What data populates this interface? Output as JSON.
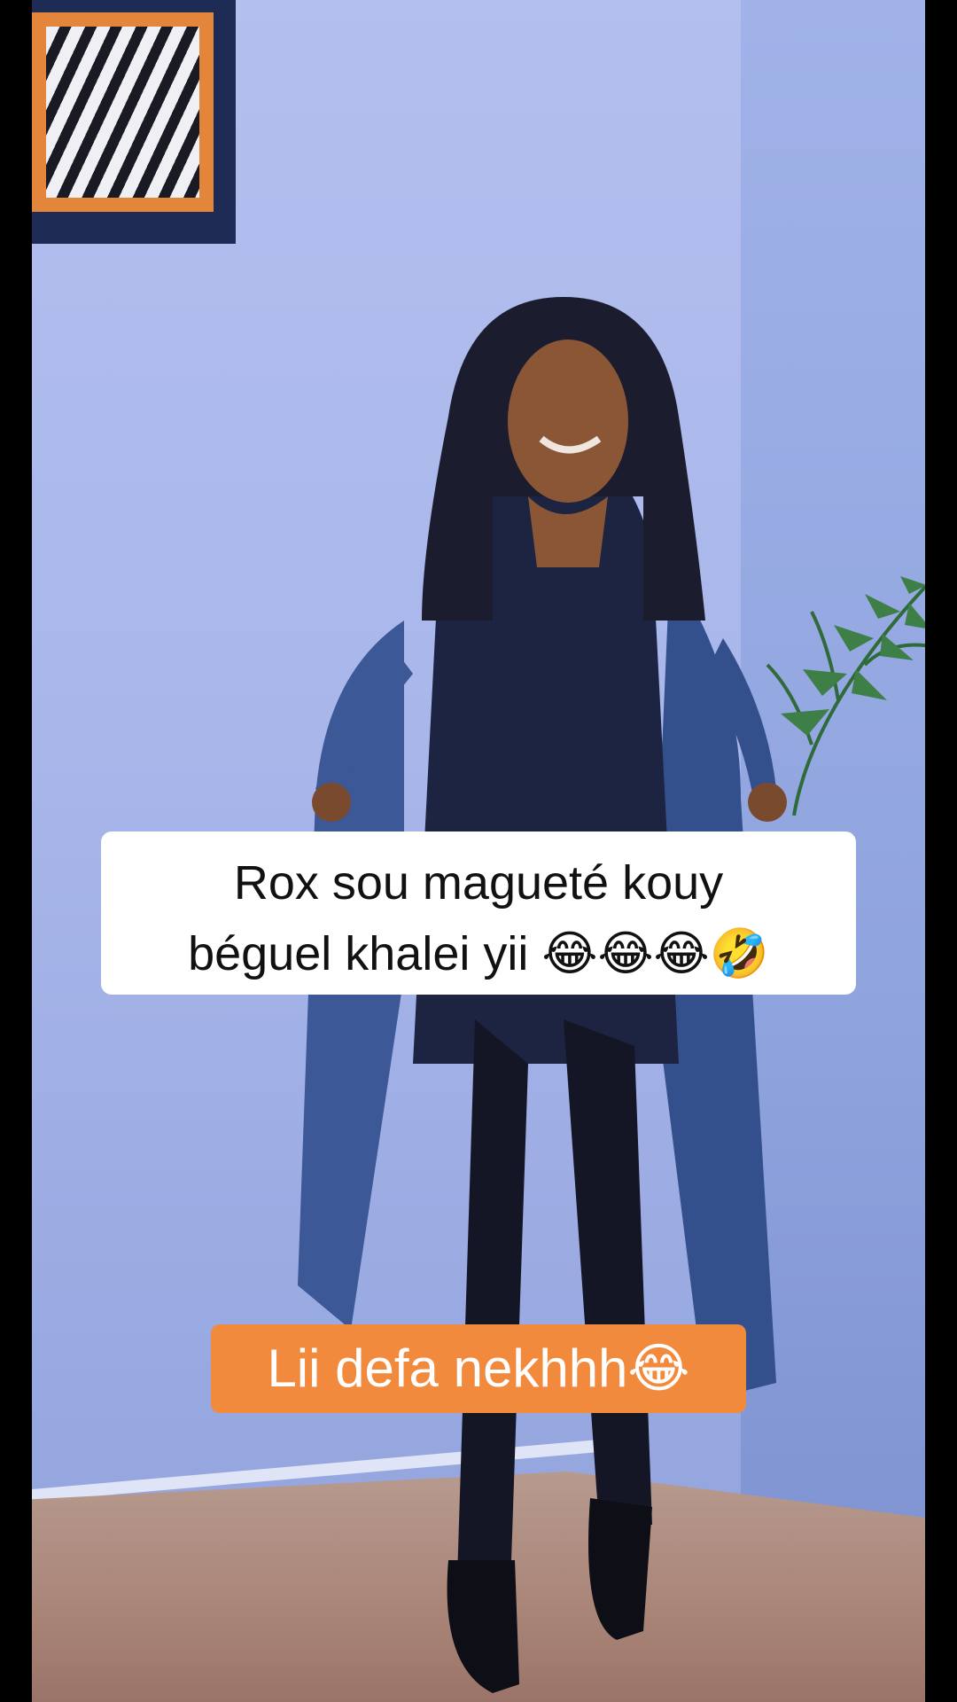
{
  "video": {
    "caption_line1": "Rox sou magueté kouy",
    "caption_line2": "béguel khalei yii 😂😂😂🤣",
    "sticker_text": "Lii defa nekhhh😂"
  },
  "colors": {
    "caption_background": "#ffffff",
    "sticker_background": "#f28a3e",
    "wall": "#a8b6ea"
  }
}
